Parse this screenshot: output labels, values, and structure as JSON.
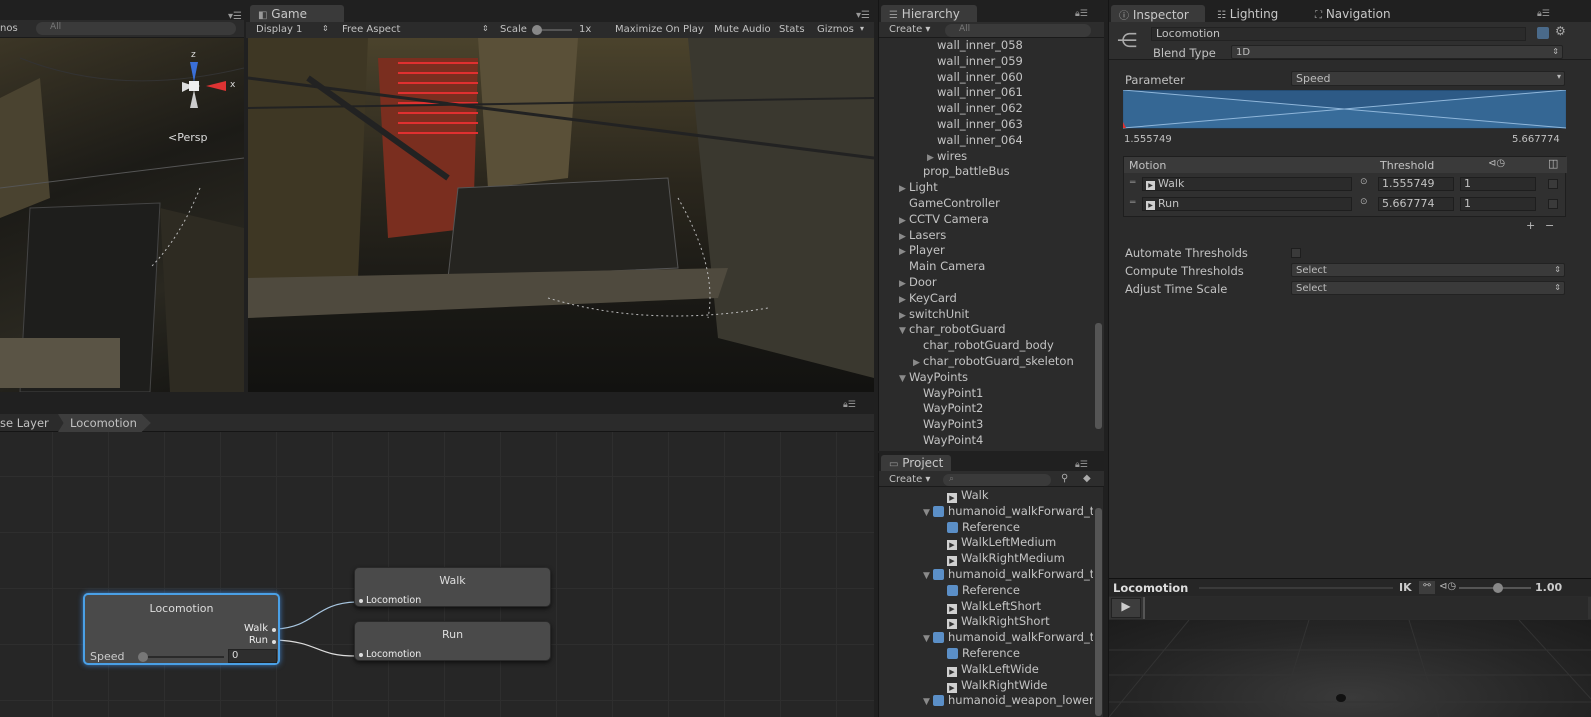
{
  "scene": {
    "search_placeholder": "All",
    "gizmos_partial": "nos",
    "persp_label": "Persp",
    "axis_x": "x",
    "axis_z": "z"
  },
  "game": {
    "tab_label": "Game",
    "display": "Display 1",
    "aspect": "Free Aspect",
    "scale_label": "Scale",
    "scale_value": "1x",
    "maximize": "Maximize On Play",
    "mute": "Mute Audio",
    "stats": "Stats",
    "gizmos": "Gizmos"
  },
  "animator": {
    "breadcrumb": [
      "se Layer",
      "Locomotion"
    ],
    "blend_node": {
      "title": "Locomotion",
      "out1": "Walk",
      "out2": "Run",
      "param": "Speed",
      "param_value": "0"
    },
    "walk_node": {
      "title": "Walk",
      "port": "Locomotion"
    },
    "run_node": {
      "title": "Run",
      "port": "Locomotion"
    }
  },
  "hierarchy": {
    "tab_label": "Hierarchy",
    "create": "Create",
    "search_placeholder": "All",
    "items": [
      {
        "label": "wall_inner_058",
        "indent": 2,
        "arrow": ""
      },
      {
        "label": "wall_inner_059",
        "indent": 2,
        "arrow": ""
      },
      {
        "label": "wall_inner_060",
        "indent": 2,
        "arrow": ""
      },
      {
        "label": "wall_inner_061",
        "indent": 2,
        "arrow": ""
      },
      {
        "label": "wall_inner_062",
        "indent": 2,
        "arrow": ""
      },
      {
        "label": "wall_inner_063",
        "indent": 2,
        "arrow": ""
      },
      {
        "label": "wall_inner_064",
        "indent": 2,
        "arrow": ""
      },
      {
        "label": "wires",
        "indent": 2,
        "arrow": "▶"
      },
      {
        "label": "prop_battleBus",
        "indent": 1,
        "arrow": ""
      },
      {
        "label": "Light",
        "indent": 0,
        "arrow": "▶"
      },
      {
        "label": "GameController",
        "indent": 0,
        "arrow": ""
      },
      {
        "label": "CCTV Camera",
        "indent": 0,
        "arrow": "▶"
      },
      {
        "label": "Lasers",
        "indent": 0,
        "arrow": "▶"
      },
      {
        "label": "Player",
        "indent": 0,
        "arrow": "▶"
      },
      {
        "label": "Main Camera",
        "indent": 0,
        "arrow": ""
      },
      {
        "label": "Door",
        "indent": 0,
        "arrow": "▶"
      },
      {
        "label": "KeyCard",
        "indent": 0,
        "arrow": "▶"
      },
      {
        "label": "switchUnit",
        "indent": 0,
        "arrow": "▶"
      },
      {
        "label": "char_robotGuard",
        "indent": 0,
        "arrow": "▼"
      },
      {
        "label": "char_robotGuard_body",
        "indent": 1,
        "arrow": ""
      },
      {
        "label": "char_robotGuard_skeleton",
        "indent": 1,
        "arrow": "▶"
      },
      {
        "label": "WayPoints",
        "indent": 0,
        "arrow": "▼"
      },
      {
        "label": "WayPoint1",
        "indent": 1,
        "arrow": ""
      },
      {
        "label": "WayPoint2",
        "indent": 1,
        "arrow": ""
      },
      {
        "label": "WayPoint3",
        "indent": 1,
        "arrow": ""
      },
      {
        "label": "WayPoint4",
        "indent": 1,
        "arrow": ""
      }
    ]
  },
  "project": {
    "tab_label": "Project",
    "create": "Create",
    "items": [
      {
        "label": "Walk",
        "indent": 2,
        "arrow": "",
        "kind": "clip"
      },
      {
        "label": "humanoid_walkForward_tu",
        "indent": 1,
        "arrow": "▼",
        "kind": "model"
      },
      {
        "label": "Reference",
        "indent": 2,
        "arrow": "",
        "kind": "model"
      },
      {
        "label": "WalkLeftMedium",
        "indent": 2,
        "arrow": "",
        "kind": "clip"
      },
      {
        "label": "WalkRightMedium",
        "indent": 2,
        "arrow": "",
        "kind": "clip"
      },
      {
        "label": "humanoid_walkForward_tu",
        "indent": 1,
        "arrow": "▼",
        "kind": "model"
      },
      {
        "label": "Reference",
        "indent": 2,
        "arrow": "",
        "kind": "model"
      },
      {
        "label": "WalkLeftShort",
        "indent": 2,
        "arrow": "",
        "kind": "clip"
      },
      {
        "label": "WalkRightShort",
        "indent": 2,
        "arrow": "",
        "kind": "clip"
      },
      {
        "label": "humanoid_walkForward_tu",
        "indent": 1,
        "arrow": "▼",
        "kind": "model"
      },
      {
        "label": "Reference",
        "indent": 2,
        "arrow": "",
        "kind": "model"
      },
      {
        "label": "WalkLeftWide",
        "indent": 2,
        "arrow": "",
        "kind": "clip"
      },
      {
        "label": "WalkRightWide",
        "indent": 2,
        "arrow": "",
        "kind": "clip"
      },
      {
        "label": "humanoid_weapon_lower",
        "indent": 1,
        "arrow": "▼",
        "kind": "model"
      }
    ]
  },
  "inspector": {
    "tabs": [
      "Inspector",
      "Lighting",
      "Navigation"
    ],
    "name": "Locomotion",
    "blend_type_label": "Blend Type",
    "blend_type": "1D",
    "parameter_label": "Parameter",
    "parameter": "Speed",
    "range_min": "1.555749",
    "range_max": "5.667774",
    "motion_header": "Motion",
    "threshold_header": "Threshold",
    "motions": [
      {
        "name": "Walk",
        "threshold": "1.555749",
        "speed": "1"
      },
      {
        "name": "Run",
        "threshold": "5.667774",
        "speed": "1"
      }
    ],
    "automate_label": "Automate Thresholds",
    "compute_label": "Compute Thresholds",
    "compute_value": "Select",
    "adjust_label": "Adjust Time Scale",
    "adjust_value": "Select",
    "preview_title": "Locomotion",
    "preview_ik": "IK",
    "preview_speed": "1.00"
  },
  "colors": {
    "accent": "#3d7bbf",
    "selected_node": "#4aa0e6",
    "graph_fill": "#2d5a86"
  }
}
